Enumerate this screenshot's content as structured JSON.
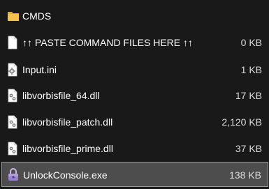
{
  "files": [
    {
      "name": "CMDS",
      "size": "",
      "icon": "folder-icon"
    },
    {
      "name": "↑↑ PASTE COMMAND FILES HERE ↑↑",
      "size": "0 KB",
      "icon": "blank-document-icon"
    },
    {
      "name": "Input.ini",
      "size": "1 KB",
      "icon": "settings-document-icon"
    },
    {
      "name": "libvorbisfile_64.dll",
      "size": "17 KB",
      "icon": "dll-gear-document-icon"
    },
    {
      "name": "libvorbisfile_patch.dll",
      "size": "2,120 KB",
      "icon": "dll-gear-document-icon"
    },
    {
      "name": "libvorbisfile_prime.dll",
      "size": "37 KB",
      "icon": "dll-gear-document-icon"
    },
    {
      "name": "UnlockConsole.exe",
      "size": "138 KB",
      "icon": "lock-app-icon",
      "selected": true
    }
  ],
  "colors": {
    "background": "#191919",
    "selection": "#4d4d4d",
    "selection_border": "#9a9a9a",
    "folder": "#f5c34a"
  }
}
